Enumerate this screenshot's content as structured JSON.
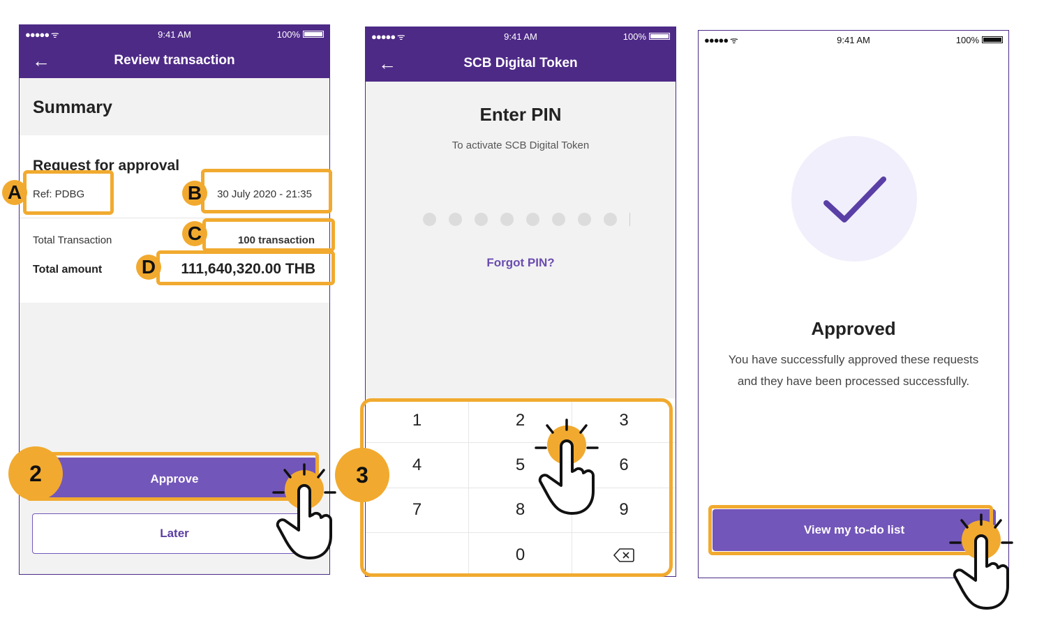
{
  "status_bar": {
    "signal": "●●●●● ᯤ",
    "time": "9:41 AM",
    "battery": "100%"
  },
  "screen1": {
    "title": "Review transaction",
    "summary_heading": "Summary",
    "request_heading": "Request for approval",
    "ref": "Ref: PDBG",
    "datetime": "30 July 2020 - 21:35",
    "total_transaction_label": "Total Transaction",
    "total_transaction_value": "100 transaction",
    "total_amount_label": "Total amount",
    "total_amount_value": "111,640,320.00 THB",
    "approve_label": "Approve",
    "later_label": "Later"
  },
  "screen2": {
    "title": "SCB Digital Token",
    "heading": "Enter PIN",
    "subtitle": "To activate SCB Digital Token",
    "forgot_label": "Forgot PIN?",
    "keys": [
      "1",
      "2",
      "3",
      "4",
      "5",
      "6",
      "7",
      "8",
      "9",
      "",
      "0",
      "⌫"
    ]
  },
  "screen3": {
    "heading": "Approved",
    "message_line1": "You have successfully approved these requests",
    "message_line2": "and they have been processed successfully.",
    "button_label": "View my to-do list"
  },
  "annotations": {
    "a": "A",
    "b": "B",
    "c": "C",
    "d": "D",
    "step2": "2",
    "step3": "3"
  },
  "colors": {
    "purple": "#4e2a87",
    "button": "#7356b9",
    "highlight": "#f1aa2f",
    "check_bg": "#f1effb"
  },
  "icons": [
    "back-arrow-icon",
    "wifi-icon",
    "battery-icon",
    "checkmark-icon",
    "backspace-icon",
    "tap-hand-icon"
  ]
}
